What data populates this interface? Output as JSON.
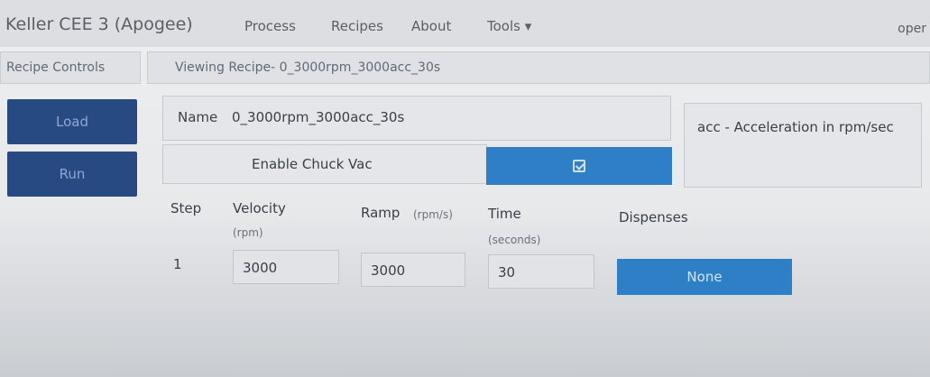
{
  "app": {
    "title": "Keller CEE 3 (Apogee)",
    "menu": [
      "Process",
      "Recipes",
      "About",
      "Tools ▾"
    ],
    "user": "oper"
  },
  "sidebar": {
    "header": "Recipe Controls",
    "buttons": [
      "Load",
      "Run"
    ]
  },
  "recipe": {
    "viewing_label": "Viewing Recipe- 0_3000rpm_3000acc_30s",
    "name_label": "Name",
    "name_value": "0_3000rpm_3000acc_30s",
    "chuck_vac_label": "Enable Chuck Vac",
    "chuck_vac_enabled": true,
    "info_note": "acc - Acceleration in rpm/sec"
  },
  "steps_table": {
    "columns": {
      "step": "Step",
      "velocity": "Velocity",
      "velocity_unit": "(rpm)",
      "ramp": "Ramp",
      "ramp_unit": "(rpm/s)",
      "time": "Time",
      "time_unit": "(seconds)",
      "dispenses": "Dispenses"
    },
    "rows": [
      {
        "step": "1",
        "velocity": "3000",
        "ramp": "3000",
        "time": "30",
        "dispenses": "None"
      }
    ]
  },
  "colors": {
    "primary_dark": "#274a82",
    "primary": "#2f7fc7"
  }
}
